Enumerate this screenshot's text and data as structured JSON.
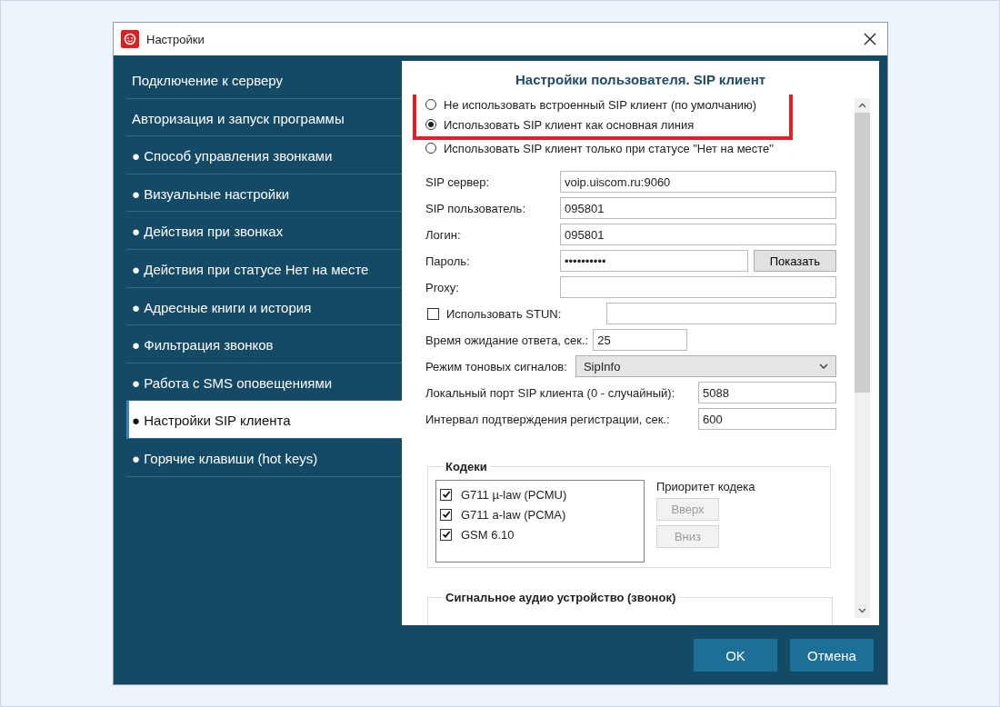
{
  "window": {
    "title": "Настройки"
  },
  "sidebar": {
    "items": [
      {
        "label": "Подключение к серверу",
        "selected": false
      },
      {
        "label": "Авторизация и запуск программы",
        "selected": false
      },
      {
        "label": "● Способ управления звонками",
        "selected": false
      },
      {
        "label": "● Визуальные настройки",
        "selected": false
      },
      {
        "label": "● Действия при звонках",
        "selected": false
      },
      {
        "label": "● Действия при статусе Нет на месте",
        "selected": false
      },
      {
        "label": "● Адресные книги и история",
        "selected": false
      },
      {
        "label": "● Фильтрация звонков",
        "selected": false
      },
      {
        "label": "● Работа с SMS оповещениями",
        "selected": false
      },
      {
        "label": "● Настройки SIP клиента",
        "selected": true
      },
      {
        "label": "● Горячие клавиши (hot keys)",
        "selected": false
      }
    ]
  },
  "panel": {
    "title": "Настройки пользователя. SIP клиент",
    "radios": [
      {
        "label": "Не использовать встроенный SIP клиент (по умолчанию)",
        "selected": false,
        "highlighted": true
      },
      {
        "label": "Использовать SIP клиент как основная линия",
        "selected": true,
        "highlighted": true
      },
      {
        "label": "Использовать SIP клиент только при статусе \"Нет на месте\"",
        "selected": false,
        "highlighted": false
      }
    ],
    "fields": [
      {
        "kind": "text",
        "label": "SIP сервер:",
        "value": "voip.uiscom.ru:9060"
      },
      {
        "kind": "text",
        "label": "SIP пользователь:",
        "value": "095801"
      },
      {
        "kind": "text",
        "label": "Логин:",
        "value": "095801"
      },
      {
        "kind": "password",
        "label": "Пароль:",
        "value": "••••••••••",
        "button": "Показать"
      },
      {
        "kind": "text",
        "label": "Proxy:"
      },
      {
        "kind": "check",
        "label": "Использовать STUN:",
        "checked": false
      },
      {
        "kind": "short",
        "label": "Время ожидание ответа, сек.:",
        "value": "25"
      },
      {
        "kind": "select",
        "label": "Режим тоновых сигналов:",
        "value": "SipInfo"
      },
      {
        "kind": "wide",
        "label": "Локальный порт SIP клиента (0 - случайный):",
        "value": "5088"
      },
      {
        "kind": "wide",
        "label": "Интервал подтверждения регистрации, сек.:",
        "value": "600"
      }
    ],
    "codecs": {
      "title": "Кодеки",
      "items": [
        {
          "label": "G711 µ-law (PCMU)",
          "checked": true
        },
        {
          "label": "G711 a-law (PCMA)",
          "checked": true
        },
        {
          "label": "GSM 6.10",
          "checked": true
        }
      ],
      "priority_label": "Приоритет кодека",
      "buttons": [
        {
          "label": "Вверх",
          "disabled": true
        },
        {
          "label": "Вниз",
          "disabled": true
        }
      ]
    },
    "audio_group": {
      "title": "Сигнальное аудио устройство (звонок)"
    }
  },
  "buttons": [
    "OK",
    "Отмена"
  ]
}
